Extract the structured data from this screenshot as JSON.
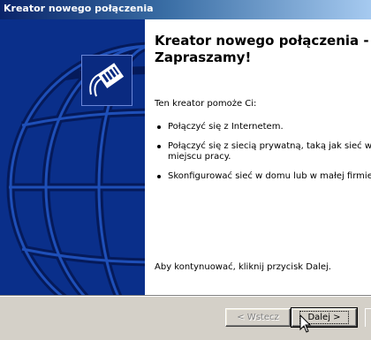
{
  "window": {
    "title": "Kreator nowego połączenia"
  },
  "content": {
    "heading": "Kreator nowego połączenia - Zapraszamy!",
    "intro": "Ten kreator pomoże Ci:",
    "bullets": [
      "Połączyć się z Internetem.",
      "Połączyć się z siecią prywatną, taką jak sieć w T\nmiejscu pracy.",
      "Skonfigurować sieć w domu lub w małej firmie."
    ],
    "footer": "Aby kontynuować, kliknij przycisk Dalej."
  },
  "buttons": {
    "back": "< Wstecz",
    "next": "Dalej >"
  },
  "icons": {
    "logo": "network-cable-icon",
    "globe": "globe-graphic",
    "cursor": "arrow-cursor-icon"
  },
  "colors": {
    "sidepanel": "#0a2f8a",
    "titlebar_start": "#0a246a",
    "titlebar_end": "#a6caf0"
  }
}
